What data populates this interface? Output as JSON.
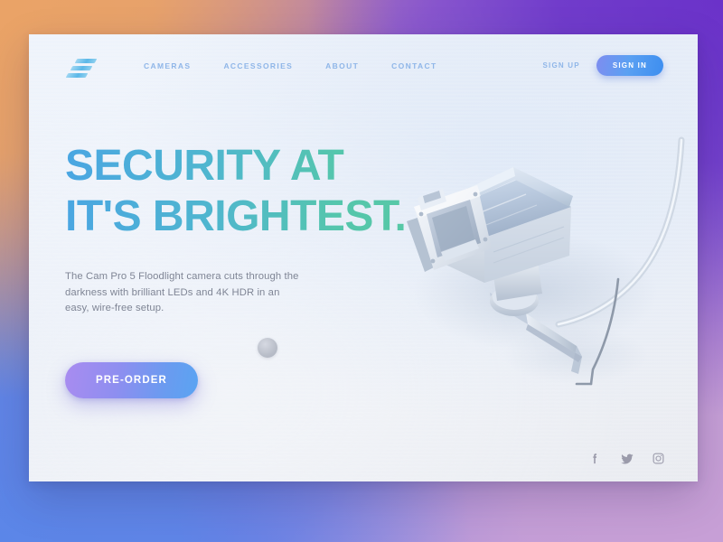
{
  "page": {
    "brand_logo_name": "stacked-bars-logo"
  },
  "header": {
    "nav": [
      {
        "label": "CAMERAS",
        "name": "nav-link-cameras"
      },
      {
        "label": "ACCESSORIES",
        "name": "nav-link-accessories"
      },
      {
        "label": "ABOUT",
        "name": "nav-link-about"
      },
      {
        "label": "CONTACT",
        "name": "nav-link-contact"
      }
    ],
    "sign_up_label": "SIGN UP",
    "sign_in_label": "SIGN IN"
  },
  "hero": {
    "headline_line_1": "SECURITY AT",
    "headline_line_2": "IT'S BRIGHTEST.",
    "subcopy": "The Cam Pro 5 Floodlight camera cuts through the darkness with brilliant LEDs and 4K HDR in an easy, wire-free setup.",
    "cta_label": "PRE-ORDER",
    "product_image_alt": "white wall-mounted cctv security camera with cable"
  },
  "social": [
    {
      "name": "facebook-icon",
      "label": "Facebook"
    },
    {
      "name": "twitter-icon",
      "label": "Twitter"
    },
    {
      "name": "instagram-icon",
      "label": "Instagram"
    }
  ],
  "colors": {
    "headline_gradient_start": "#4aa6e2",
    "headline_gradient_end": "#58c9a3",
    "nav_link": "#8fb6e8",
    "sign_in_gradient_start": "#7e8df0",
    "sign_in_gradient_end": "#3d8ef0",
    "cta_gradient_start": "#a98cf0",
    "cta_gradient_end": "#5aa4f2",
    "backdrop_top_left": "#eaa367",
    "backdrop_top_right": "#6b32c9",
    "backdrop_bottom_left": "#5b86e8",
    "backdrop_bottom_right": "#c79fd6",
    "card_background": "#eef3fa",
    "body_text": "#7f8595",
    "social_icon": "#9b9bab"
  }
}
